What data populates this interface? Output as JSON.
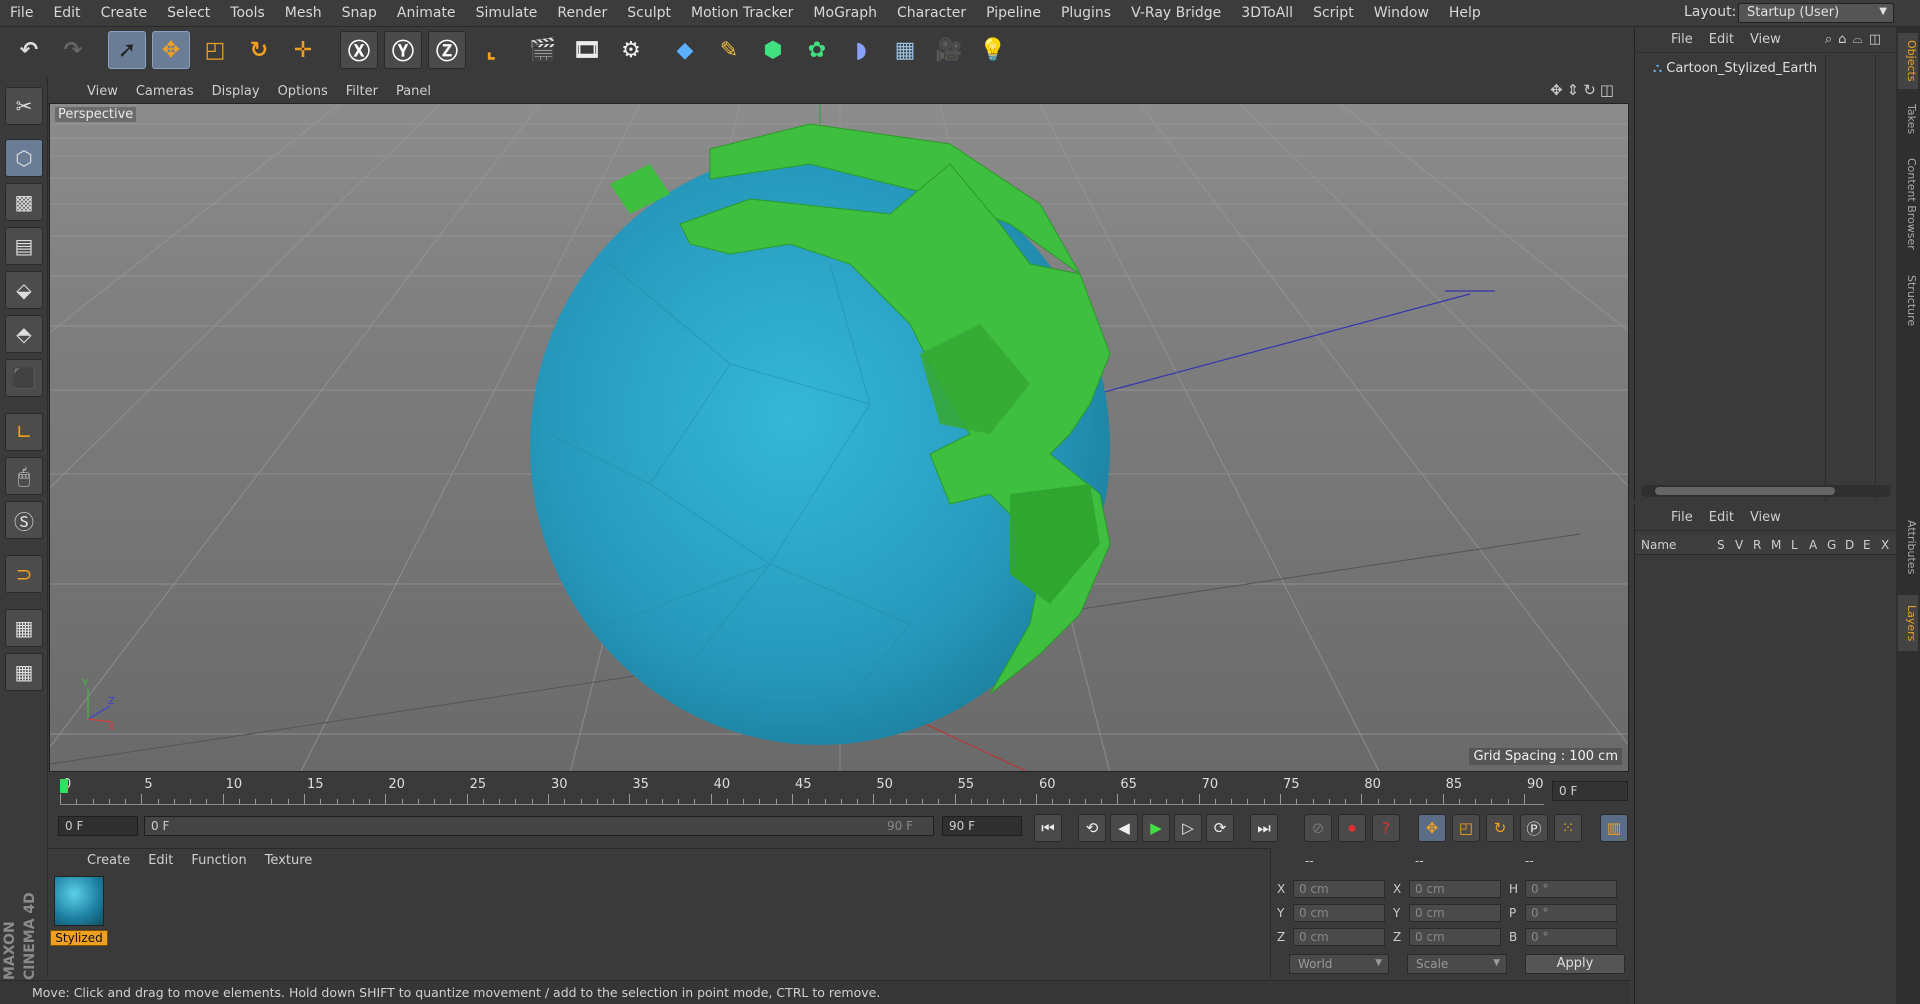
{
  "menubar": {
    "items": [
      "File",
      "Edit",
      "Create",
      "Select",
      "Tools",
      "Mesh",
      "Snap",
      "Animate",
      "Simulate",
      "Render",
      "Sculpt",
      "Motion Tracker",
      "MoGraph",
      "Character",
      "Pipeline",
      "Plugins",
      "V-Ray Bridge",
      "3DToAll",
      "Script",
      "Window",
      "Help"
    ],
    "layout_label": "Layout:",
    "layout_value": "Startup (User)"
  },
  "viewport": {
    "menu": [
      "View",
      "Cameras",
      "Display",
      "Options",
      "Filter",
      "Panel"
    ],
    "view_name": "Perspective",
    "grid_spacing": "Grid Spacing : 100 cm"
  },
  "timeline": {
    "labels": [
      "0",
      "5",
      "10",
      "15",
      "20",
      "25",
      "30",
      "35",
      "40",
      "45",
      "50",
      "55",
      "60",
      "65",
      "70",
      "75",
      "80",
      "85",
      "90"
    ],
    "end_field": "0 F",
    "current_frame": "0 F",
    "range_start": "0 F",
    "range_end_inner": "90 F",
    "range_end": "90 F"
  },
  "material": {
    "menu": [
      "Create",
      "Edit",
      "Function",
      "Texture"
    ],
    "name": "Stylized"
  },
  "coords": {
    "headers": [
      "--",
      "--",
      "--"
    ],
    "rows": [
      {
        "a": "X",
        "v1": "0 cm",
        "b": "X",
        "v2": "0 cm",
        "c": "H",
        "v3": "0 °"
      },
      {
        "a": "Y",
        "v1": "0 cm",
        "b": "Y",
        "v2": "0 cm",
        "c": "P",
        "v3": "0 °"
      },
      {
        "a": "Z",
        "v1": "0 cm",
        "b": "Z",
        "v2": "0 cm",
        "c": "B",
        "v3": "0 °"
      }
    ],
    "mode1": "World",
    "mode2": "Scale",
    "apply": "Apply"
  },
  "status": "Move: Click and drag to move elements. Hold down SHIFT to quantize movement / add to the selection in point mode, CTRL to remove.",
  "brand": "MAXON CINEMA 4D",
  "objects": {
    "menu": [
      "File",
      "Edit",
      "View"
    ],
    "item": "Cartoon_Stylized_Earth"
  },
  "layers": {
    "menu": [
      "File",
      "Edit",
      "View"
    ],
    "columns": [
      "Name",
      "S",
      "V",
      "R",
      "M",
      "L",
      "A",
      "G",
      "D",
      "E",
      "X"
    ]
  },
  "side_tabs": [
    "Objects",
    "Takes",
    "Content Browser",
    "Structure",
    "Attributes",
    "Layers"
  ],
  "colors": {
    "ocean": "#2aa6c8",
    "land": "#3fbf3f",
    "accent": "#f0a020",
    "select": "#6a7c96"
  }
}
